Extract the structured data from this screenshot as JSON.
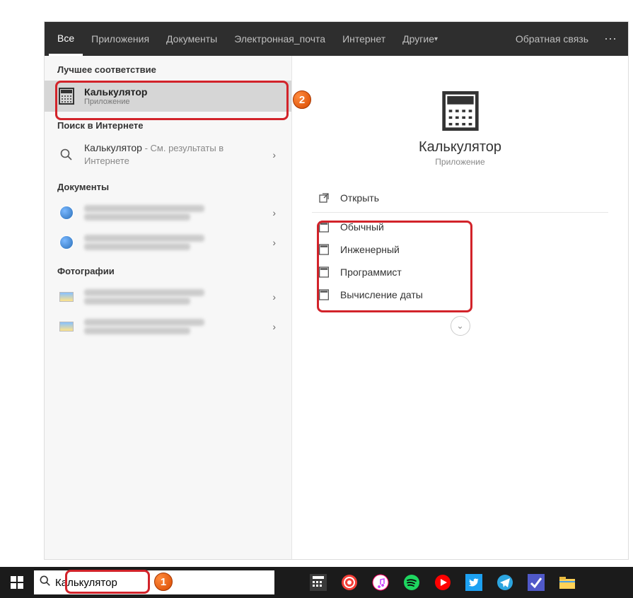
{
  "topbar": {
    "tabs": [
      "Все",
      "Приложения",
      "Документы",
      "Электронная_почта",
      "Интернет",
      "Другие"
    ],
    "feedback": "Обратная связь"
  },
  "left": {
    "best_match_header": "Лучшее соответствие",
    "best_match": {
      "title": "Калькулятор",
      "subtitle": "Приложение"
    },
    "web_header": "Поиск в Интернете",
    "web_item": {
      "title": "Калькулятор",
      "subtitle": " - См. результаты в Интернете"
    },
    "docs_header": "Документы",
    "photos_header": "Фотографии"
  },
  "right": {
    "app_name": "Калькулятор",
    "app_type": "Приложение",
    "open": "Открыть",
    "modes": [
      "Обычный",
      "Инженерный",
      "Программист",
      "Вычисление даты"
    ]
  },
  "taskbar": {
    "search_value": "Калькулятор"
  },
  "colors": {
    "callout": "#d2232a",
    "topbar_bg": "#2e2e2e",
    "selected_bg": "#d6d6d6"
  }
}
